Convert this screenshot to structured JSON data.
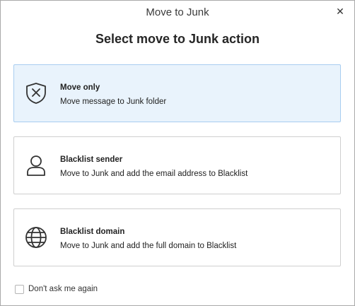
{
  "window": {
    "title": "Move to Junk"
  },
  "heading": "Select move to Junk action",
  "options": [
    {
      "title": "Move only",
      "description": "Move message to Junk folder",
      "icon": "shield-x-icon",
      "selected": true
    },
    {
      "title": "Blacklist sender",
      "description": "Move to Junk and add the email address to Blacklist",
      "icon": "person-icon",
      "selected": false
    },
    {
      "title": "Blacklist domain",
      "description": "Move to Junk and add the full domain to Blacklist",
      "icon": "globe-icon",
      "selected": false
    }
  ],
  "dont_ask": {
    "label": "Don't ask me again",
    "checked": false
  },
  "colors": {
    "selected_bg": "#e9f3fc",
    "selected_border": "#a8cdf0",
    "border": "#cfcfcf"
  }
}
